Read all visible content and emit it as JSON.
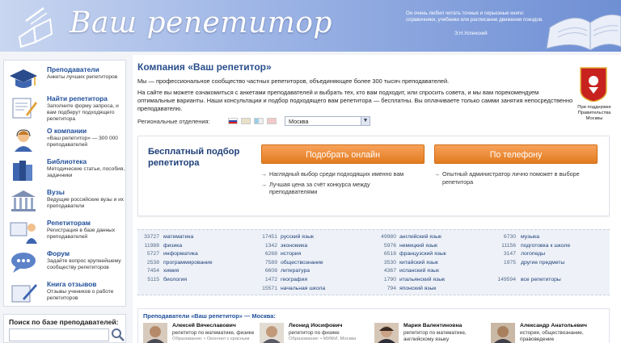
{
  "header": {
    "title": "Ваш репетитор",
    "quote": "Он очень любил читать точные и серьезные книги: справочники, учебники или расписание движения поездов.",
    "quote_author": "Э.Н.Успенский"
  },
  "sidebar": {
    "items": [
      {
        "title": "Преподаватели",
        "desc": "Анкеты лучших репетиторов",
        "icon": "graduation-cap-icon"
      },
      {
        "title": "Найти репетитора",
        "desc": "Заполните форму запроса, и вам подберут подходящего репетитора",
        "icon": "pencil-form-icon"
      },
      {
        "title": "О компании",
        "desc": "«Ваш репетитор» — 300 000 преподавателей",
        "icon": "person-headset-icon"
      },
      {
        "title": "Библиотека",
        "desc": "Методические статьи, пособия, задачники",
        "icon": "books-icon"
      },
      {
        "title": "Вузы",
        "desc": "Ведущие российские вузы и их преподаватели",
        "icon": "university-icon"
      },
      {
        "title": "Репетиторам",
        "desc": "Регистрация в базе данных преподавателей",
        "icon": "tutor-icon"
      },
      {
        "title": "Форум",
        "desc": "Задайте вопрос крупнейшему сообществу репетиторов",
        "icon": "chat-bubble-icon"
      },
      {
        "title": "Книга отзывов",
        "desc": "Отзывы учеников о работе репетиторов",
        "icon": "feedback-book-icon"
      }
    ],
    "search_label": "Поиск по базе преподавателей:"
  },
  "main": {
    "title": "Компания «Ваш репетитор»",
    "intro": "Мы — профессиональное сообщество частных репетиторов, объединяющее более 300 тысяч преподавателей.",
    "intro2": "На сайте вы можете ознакомиться с анкетами преподавателей и выбрать тех, кто вам подходит, или спросить совета, и мы вам порекомендуем оптимальные варианты. Наши консультации и подбор подходящего вам репетитора — бесплатны. Вы оплачиваете только самми занятия непосредственно преподавателю.",
    "regions_label": "Региональные отделения:",
    "city": "Москва",
    "moscow_caption": "При поддержке Правительства Москвы"
  },
  "free_box": {
    "heading": "Бесплатный подбор репетитора",
    "online_button": "Подобрать онлайн",
    "phone_button": "По телефону",
    "online_points": [
      "Наглядный выбор среди подходящих именно вам",
      "Лучшая цена за счёт конкурса между преподавателями"
    ],
    "phone_points": [
      "Опытный администратор лично поможет в выборе репетитора"
    ]
  },
  "subjects": {
    "columns": [
      [
        {
          "count": "33727",
          "name": "математика"
        },
        {
          "count": "11988",
          "name": "физика"
        },
        {
          "count": "5727",
          "name": "информатика"
        },
        {
          "count": "2538",
          "name": "программирование"
        },
        {
          "count": "7454",
          "name": "химия"
        },
        {
          "count": "5115",
          "name": "биология"
        }
      ],
      [
        {
          "count": "17451",
          "name": "русский язык"
        },
        {
          "count": "1342",
          "name": "экономика"
        },
        {
          "count": "6268",
          "name": "история"
        },
        {
          "count": "7589",
          "name": "обществознание"
        },
        {
          "count": "6608",
          "name": "литература"
        },
        {
          "count": "1472",
          "name": "география"
        },
        {
          "count": "15571",
          "name": "начальная школа"
        }
      ],
      [
        {
          "count": "49980",
          "name": "английский язык"
        },
        {
          "count": "5976",
          "name": "немецкий язык"
        },
        {
          "count": "6518",
          "name": "французский язык"
        },
        {
          "count": "3530",
          "name": "китайский язык"
        },
        {
          "count": "4367",
          "name": "испанский язык"
        },
        {
          "count": "1790",
          "name": "итальянский язык"
        },
        {
          "count": "794",
          "name": "японский язык"
        }
      ],
      [
        {
          "count": "6730",
          "name": "музыка"
        },
        {
          "count": "11156",
          "name": "подготовка к школе"
        },
        {
          "count": "3147",
          "name": "логопеды"
        },
        {
          "count": "1975",
          "name": "другие предметы"
        },
        {
          "count": "",
          "name": ""
        },
        {
          "count": "149594",
          "name": "все репетиторы"
        }
      ]
    ]
  },
  "tutors": {
    "heading": "Преподаватели «Ваш репетитор» — Москва:",
    "cards": [
      {
        "name": "Алексей Вячеславович",
        "desc": "репетитор по математике, физике",
        "edu": "Образование: • Окончил с красным"
      },
      {
        "name": "Леонид Иосифович",
        "desc": "репетитор по физике",
        "edu": "Образование: • МИФИ, Москва"
      },
      {
        "name": "Мария Валентиновна",
        "desc": "репетитор по математике, английскому языку",
        "edu": ""
      },
      {
        "name": "Александр Анатольевич",
        "desc": "история, обществознание, правоведение",
        "edu": ""
      }
    ]
  },
  "colors": {
    "accent_orange": "#e8872f",
    "link_blue": "#1f4e9a",
    "header_blue": "#7f9ad8"
  }
}
